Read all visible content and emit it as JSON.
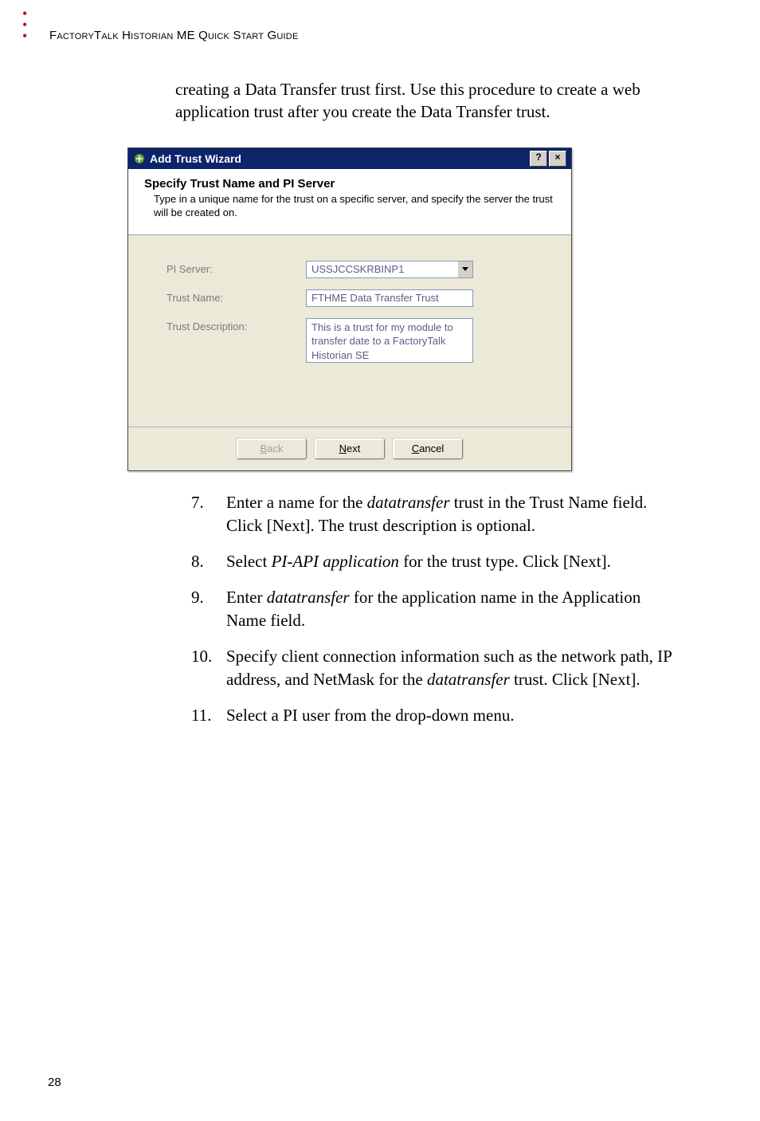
{
  "header": {
    "doc_title": "FactoryTalk Historian ME Quick Start Guide"
  },
  "intro": "creating a Data Transfer trust first. Use this procedure to create a web application trust after you create the Data Transfer trust.",
  "wizard": {
    "title": "Add Trust Wizard",
    "help_btn": "?",
    "close_btn": "×",
    "step_title": "Specify Trust Name and PI Server",
    "step_desc": "Type in a unique name for the trust on a specific server, and specify the server the trust will be created on.",
    "labels": {
      "pi_server": "PI Server:",
      "trust_name": "Trust Name:",
      "trust_desc": "Trust Description:"
    },
    "values": {
      "pi_server": "USSJCCSKRBINP1",
      "trust_name": "FTHME Data Transfer Trust",
      "trust_desc": "This is a trust for my module to transfer date to a FactoryTalk Historian SE"
    },
    "buttons": {
      "back": "Back",
      "next": "Next",
      "cancel": "Cancel"
    }
  },
  "steps": {
    "s7": {
      "num": "7.",
      "prefix": "Enter a name for the ",
      "em1": "datatransfer",
      "mid": " trust in the Trust Name field. Click [Next]. The trust description is optional."
    },
    "s8": {
      "num": "8.",
      "prefix": "Select ",
      "em1": "PI-API application",
      "mid": " for the trust type. Click [Next]."
    },
    "s9": {
      "num": "9.",
      "prefix": "Enter ",
      "em1": "datatransfer",
      "mid": " for the application name in the Application Name field."
    },
    "s10": {
      "num": "10.",
      "prefix": "Specify client connection information such as the network path, IP address, and NetMask for the ",
      "em1": "datatransfer",
      "mid": " trust. Click [Next]."
    },
    "s11": {
      "num": "11.",
      "text": "Select a PI user from the drop-down menu."
    }
  },
  "page_number": "28"
}
